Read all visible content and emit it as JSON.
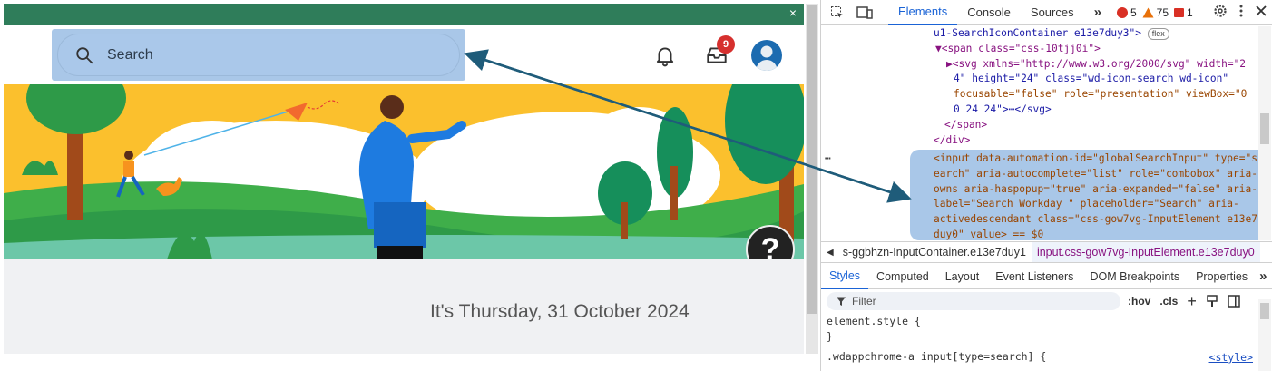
{
  "app": {
    "search": {
      "placeholder": "Search"
    },
    "notifications": {
      "inbox_count": "9"
    },
    "greeting": "It's Thursday, 31 October 2024",
    "help_glyph": "?",
    "close_glyph": "×"
  },
  "devtools": {
    "tabs": [
      "Elements",
      "Console",
      "Sources"
    ],
    "more_tabs": "»",
    "errors": "5",
    "warnings": "75",
    "issues": "1",
    "code_lines": {
      "l1a": "u1-SearchIconContainer e13e7duy3\">",
      "l1badge": "flex",
      "l2": "▼<span class=\"css-10tjj0i\">",
      "l3": "▶<svg xmlns=\"http://www.w3.org/2000/svg\" width=\"2",
      "l4": "4\" height=\"24\" class=\"wd-icon-search wd-icon\"",
      "l5": "focusable=\"false\" role=\"presentation\" viewBox=\"0",
      "l6": "0 24 24\">⋯</svg>",
      "l7": "</span>",
      "l8": "</div>",
      "s1": "<input data-automation-id=\"globalSearchInput\" type=\"s",
      "s2": "earch\" aria-autocomplete=\"list\" role=\"combobox\" aria-",
      "s3": "owns aria-haspopup=\"true\" aria-expanded=\"false\" aria-",
      "s4": "label=\"Search Workday \" placeholder=\"Search\" aria-",
      "s5": "activedescendant class=\"css-gow7vg-InputElement e13e7",
      "s6": "duy0\" value> == $0"
    },
    "ellipsis": "⋯",
    "breadcrumbs": [
      "s-ggbhzn-InputContainer.e13e7duy1",
      "input.css-gow7vg-InputElement.e13e7duy0"
    ],
    "sub_tabs": [
      "Styles",
      "Computed",
      "Layout",
      "Event Listeners",
      "DOM Breakpoints",
      "Properties"
    ],
    "sub_more": "»",
    "filter_placeholder": "Filter",
    "filter_tools": [
      ":hov",
      ".cls",
      "+"
    ],
    "styles": {
      "line1": "element.style {",
      "line2": "}",
      "line3": ".wdappchrome-a input[type=search] {",
      "source": "<style>"
    }
  },
  "colors": {
    "banner": "#2f7d5a",
    "highlight": "#a9c7e8",
    "accent_blue": "#1a63d6",
    "arrow": "#1f5c7a",
    "badge_red": "#d6302e"
  }
}
